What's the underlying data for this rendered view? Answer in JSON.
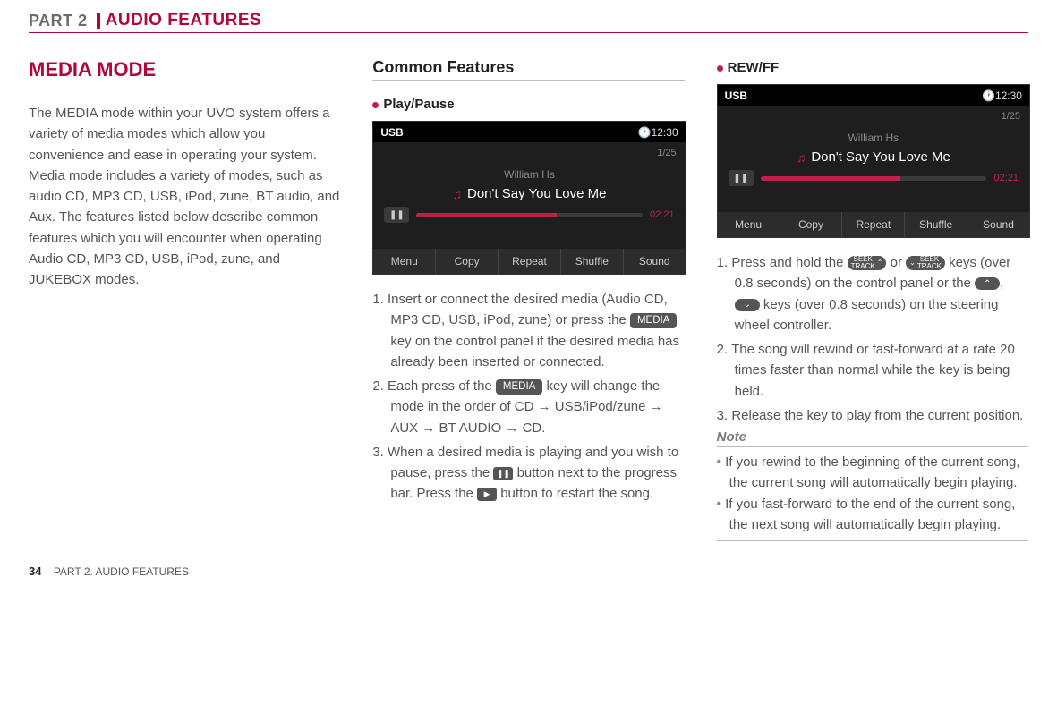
{
  "header": {
    "part": "PART 2",
    "title": "AUDIO FEATURES"
  },
  "col1": {
    "title": "MEDIA MODE",
    "paragraph": "The MEDIA mode within your UVO system offers a variety of media modes which allow you convenience and ease in operating your system. Media mode includes a variety of modes, such as audio CD, MP3 CD, USB, iPod, zune, BT audio, and Aux. The features listed below describe common features which you will encounter when operating Audio CD, MP3 CD, USB, iPod, zune, and JUKEBOX modes."
  },
  "col2": {
    "heading": "Common Features",
    "sub_heading": "Play/Pause",
    "screenshot": {
      "source_label": "USB",
      "clock": "12:30",
      "track_count": "1/25",
      "artist": "William Hs",
      "track": "Don't Say You Love Me",
      "elapsed": "02:21",
      "buttons": [
        "Menu",
        "Copy",
        "Repeat",
        "Shuffle",
        "Sound"
      ]
    },
    "steps": [
      {
        "n": "1.",
        "pre": "Insert or connect the desired media (Audio CD, MP3 CD, USB, iPod, zune) or press the ",
        "key": "MEDIA",
        "post": " key on the control panel if the desired media has already been inserted or connected."
      },
      {
        "n": "2.",
        "pre": "Each press of the ",
        "key": "MEDIA",
        "post": " key will change the mode in the order of CD → USB/iPod/zune → AUX → BT AUDIO → CD."
      },
      {
        "n": "3.",
        "pre": "When a desired media is playing and you wish to pause, press the ",
        "pause": true,
        "mid": " button next to the progress bar. Press the ",
        "play": true,
        "post": " button to restart the song."
      }
    ]
  },
  "col3": {
    "sub_heading": "REW/FF",
    "screenshot": {
      "source_label": "USB",
      "clock": "12:30",
      "track_count": "1/25",
      "artist": "William Hs",
      "track": "Don't Say You Love Me",
      "elapsed": "02:21",
      "buttons": [
        "Menu",
        "Copy",
        "Repeat",
        "Shuffle",
        "Sound"
      ]
    },
    "step1_pre": "Press and hold the ",
    "step1_or": " or ",
    "step1_mid": " keys (over 0.8 seconds) on the control panel or the ",
    "step1_comma": ", ",
    "step1_post": " keys (over 0.8 seconds) on the steering wheel controller.",
    "step2": "2. The song will rewind or fast-forward at a rate 20 times faster than normal while the key is being held.",
    "step3": "3. Release the key to play from the current position.",
    "note_label": "Note",
    "note1": "If you rewind to the beginning of the current song, the current song will automatically begin playing.",
    "note2": "If you fast-forward to the end of the current song, the next song will automatically begin playing.",
    "seek_track_label": "SEEK\nTRACK"
  },
  "footer": {
    "page_num": "34",
    "caption": "PART 2. AUDIO FEATURES"
  },
  "icons": {
    "clock_glyph": "🕐",
    "note_glyph": "♫",
    "pause_glyph": "❚❚",
    "play_glyph": "▶",
    "up_glyph": "⌃",
    "down_glyph": "⌄"
  }
}
